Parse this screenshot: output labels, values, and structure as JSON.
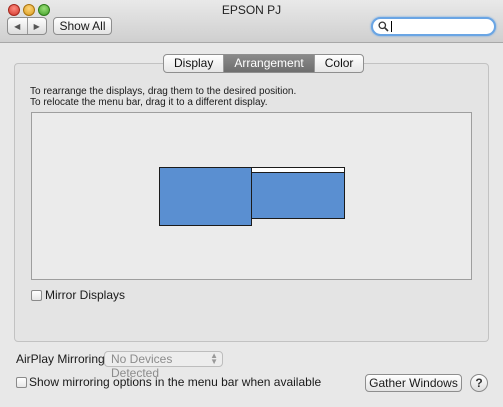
{
  "window": {
    "title": "EPSON PJ"
  },
  "toolbar": {
    "back_glyph": "◀",
    "forward_glyph": "▶",
    "show_all_label": "Show All",
    "search_value": ""
  },
  "tabs": [
    {
      "label": "Display",
      "active": false
    },
    {
      "label": "Arrangement",
      "active": true
    },
    {
      "label": "Color",
      "active": false
    }
  ],
  "arrangement": {
    "instruction_1": "To rearrange the displays, drag them to the desired position.",
    "instruction_2": "To relocate the menu bar, drag it to a different display.",
    "display_color": "#5a8fd1"
  },
  "mirror_displays": {
    "label": "Mirror Displays",
    "checked": false
  },
  "airplay": {
    "label": "AirPlay Mirroring:",
    "selected": "No Devices Detected",
    "enabled": false
  },
  "show_mirroring_options": {
    "label": "Show mirroring options in the menu bar when available",
    "checked": false
  },
  "gather_windows_label": "Gather Windows",
  "help_glyph": "?"
}
